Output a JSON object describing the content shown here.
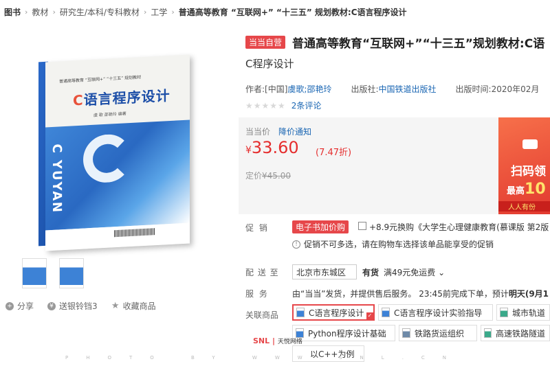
{
  "breadcrumb": [
    "图书",
    "教材",
    "研究生/本科/专科教材",
    "工学",
    "普通高等教育 “互联网+” “十三五” 规划教材:C语言程序设计"
  ],
  "cover": {
    "series_text": "普通高等教育 “互联网+” “十三五” 规划教材",
    "title_c": "C",
    "title_rest": "语言程序设计",
    "authors_text": "虞 歌   邵艳玲 编著",
    "vertical_text": "C YUYAN"
  },
  "actions": {
    "share": "分享",
    "send_coin": "送银铃铛3",
    "favorite": "收藏商品"
  },
  "product": {
    "badge": "当当自营",
    "title": "普通高等教育“互联网+”“十三五”规划教材:C语",
    "subtitle": "C程序设计",
    "author_label": "作者:[中国]",
    "author_names": "虞歌;邵艳玲",
    "publisher_label": "出版社:",
    "publisher": "中国铁道出版社",
    "pubdate": "出版时间:2020年02月",
    "stars": "★★★★★",
    "reviews": "2条评论"
  },
  "price": {
    "label": "当当价",
    "notify": "降价通知",
    "yen": "¥",
    "value": "33.60",
    "discount": "(7.47折)",
    "list_label": "定价",
    "list_value": "¥45.00"
  },
  "banner": {
    "scan": "扫码领",
    "max_prefix": "最高",
    "max_value": "10",
    "all": "人人有份"
  },
  "promo": {
    "label": "促  销",
    "tag": "电子书加价购",
    "text": "+8.9元换购《大学生心理健康教育(慕课版 第2版",
    "note": "促销不可多选，请在购物车选择该单品能享受的促销"
  },
  "delivery": {
    "label": "配 送 至",
    "region": "北京市东城区",
    "stock": "有货",
    "ship": "满49元免运费"
  },
  "service": {
    "label": "服  务",
    "text_prefix": "由“当当”发货，并提供售后服务。 23:45前完成下单，预计",
    "text_bold": "明天(9月1"
  },
  "related": {
    "label": "关联商品",
    "items": [
      "C语言程序设计",
      "C语言程序设计实验指导",
      "城市轨道",
      "Python程序设计基础",
      "铁路货运组织",
      "高速铁路隧道",
      "以C++为例"
    ]
  },
  "watermark": {
    "logo": "SNL",
    "logo_sub": "天悦网络",
    "line": "PHOTO BY WWW.SNL.CN"
  }
}
